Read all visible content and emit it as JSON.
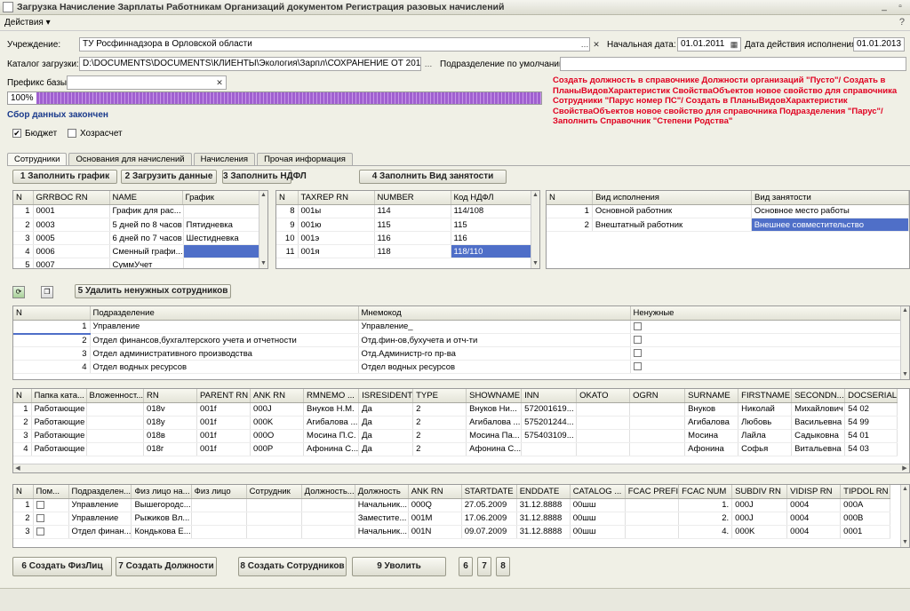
{
  "window": {
    "title": "Загрузка Начисление Зарплаты Работникам Организаций документом Регистрация разовых начислений",
    "minimize": "_",
    "restore": "▫"
  },
  "menu": {
    "actions": "Действия ▾",
    "help": "?"
  },
  "form": {
    "institution_label": "Учреждение:",
    "institution_value": "ТУ Росфиннадзора в Орловской области",
    "start_date_label": "Начальная дата:",
    "start_date_value": "01.01.2011",
    "exec_date_label": "Дата действия исполнения:",
    "exec_date_value": "01.01.2013",
    "catalog_label": "Каталог загрузки:",
    "catalog_value": "D:\\DOCUMENTS\\DOCUMENTS\\КЛИЕНТЫ\\Экология\\Зарпл\\СОХРАНЕНИЕ ОТ 2013-02-07",
    "dept_default_label": "Подразделение по умолчанию:",
    "dept_default_value": "",
    "prefix_label": "Префикс базы:",
    "prefix_value": "",
    "progress_text": "100%",
    "progress_value": 1.0,
    "done_text": "Сбор данных закончен",
    "budget_label": "Бюджет",
    "budget_checked": true,
    "selfsup_label": "Хозрасчет",
    "selfsup_checked": false,
    "red_note": "Создать должность в справочнике Должности организаций \"Пусто\"/ Создать в ПланыВидовХарактеристик СвойстваОбъектов новое свойство для справочника Сотрудники \"Парус номер ПС\"/ Создать в ПланыВидовХарактеристик СвойстваОбъектов новое свойство для справочника Подразделения \"Парус\"/Заполнить Справочник \"Степени Родства\""
  },
  "tabs": [
    "Сотрудники",
    "Основания для начислений",
    "Начисления",
    "Прочая информация"
  ],
  "buttons": {
    "fill_schedule": "1 Заполнить график",
    "load_data": "2 Загрузить данные",
    "fill_ndfl": "3 Заполнить НДФЛ",
    "fill_employment": "4 Заполнить Вид занятости",
    "delete_unneeded": "5 Удалить ненужных сотрудников",
    "create_persons": "6 Создать ФизЛиц",
    "create_positions": "7 Создать Должности",
    "create_employees": "8 Создать Сотрудников",
    "dismiss": "9 Уволить",
    "b6": "6",
    "b7": "7",
    "b8": "8"
  },
  "grid_schedule": {
    "columns": [
      "N",
      "GRRBOC RN",
      "NAME",
      "График"
    ],
    "rows": [
      [
        "1",
        "0001",
        "График для рас...",
        ""
      ],
      [
        "2",
        "0003",
        "5 дней по 8 часов",
        "Пятидневка"
      ],
      [
        "3",
        "0005",
        "6 дней по 7 часов",
        "Шестидневка"
      ],
      [
        "4",
        "0006",
        "Сменный графи...",
        ""
      ],
      [
        "5",
        "0007",
        "СуммУчет",
        ""
      ]
    ]
  },
  "grid_tax": {
    "columns": [
      "N",
      "TAXREP RN",
      "NUMBER",
      "Код НДФЛ"
    ],
    "rows": [
      [
        "8",
        "001ы",
        "114",
        "114/108"
      ],
      [
        "9",
        "001ю",
        "115",
        "115"
      ],
      [
        "10",
        "001э",
        "116",
        "116"
      ],
      [
        "11",
        "001я",
        "118",
        "118/110"
      ]
    ]
  },
  "grid_exec": {
    "columns": [
      "N",
      "Вид исполнения",
      "Вид занятости"
    ],
    "rows": [
      [
        "1",
        "Основной работник",
        "Основное место работы"
      ],
      [
        "2",
        "Внештатный работник",
        "Внешнее совместительство"
      ]
    ]
  },
  "grid_depts": {
    "columns": [
      "N",
      "Подразделение",
      "Мнемокод",
      "Ненужные"
    ],
    "rows": [
      [
        "1",
        "Управление",
        "Управление_",
        false
      ],
      [
        "2",
        "Отдел финансов,бухгалтерского учета и отчетности",
        "Отд.фин-ов,бухучета и отч-ти",
        false
      ],
      [
        "3",
        "Отдел административного производства",
        "Отд.Администр-го пр-ва",
        false
      ],
      [
        "4",
        "Отдел водных ресурсов",
        "Отдел водных ресурсов",
        false
      ]
    ]
  },
  "grid_persons": {
    "columns": [
      "N",
      "Папка ката...",
      "Вложенност...",
      "RN",
      "PARENT RN",
      "ANK RN",
      "RMNEMO ...",
      "ISRESIDENT",
      "TYPE",
      "SHOWNAME",
      "INN",
      "OKATO",
      "OGRN",
      "SURNAME",
      "FIRSTNAME",
      "SECONDN...",
      "DOCSERIAL"
    ],
    "rows": [
      [
        "1",
        "Работающие",
        "",
        "018v",
        "001f",
        "000J",
        "Внуков Н.М.",
        "Да",
        "2",
        "Внуков Ни...",
        "572001619...",
        "",
        "",
        "Внуков",
        "Николай",
        "Михайлович",
        "54 02"
      ],
      [
        "2",
        "Работающие",
        "",
        "018y",
        "001f",
        "000K",
        "Агибалова ...",
        "Да",
        "2",
        "Агибалова ...",
        "575201244...",
        "",
        "",
        "Агибалова",
        "Любовь",
        "Васильевна",
        "54 99"
      ],
      [
        "3",
        "Работающие",
        "",
        "018в",
        "001f",
        "000O",
        "Мосина П.С.",
        "Да",
        "2",
        "Мосина Па...",
        "575403109...",
        "",
        "",
        "Мосина",
        "Лайла",
        "Садыковна",
        "54 01"
      ],
      [
        "4",
        "Работающие",
        "",
        "018г",
        "001f",
        "000P",
        "Афонина С...",
        "Да",
        "2",
        "Афонина С...",
        "",
        "",
        "",
        "Афонина",
        "Софья",
        "Витальевна",
        "54 03"
      ]
    ]
  },
  "grid_staff": {
    "columns": [
      "N",
      "Пом...",
      "Подразделен...",
      "Физ лицо на...",
      "Физ лицо",
      "Сотрудник",
      "Должность...",
      "Должность",
      "ANK RN",
      "STARTDATE",
      "ENDDATE",
      "CATALOG ...",
      "FCAC PREFI",
      "FCAC NUM",
      "SUBDIV RN",
      "VIDISP RN",
      "TIPDOL RN"
    ],
    "rows": [
      [
        "1",
        "",
        "Управление",
        "Вышегородс...",
        "",
        "",
        "",
        "Начальник...",
        "000Q",
        "27.05.2009",
        "31.12.8888",
        "00шш",
        "",
        "1.",
        "000J",
        "0004",
        "000A"
      ],
      [
        "2",
        "",
        "Управление",
        "Рыжиков Вл...",
        "",
        "",
        "",
        "Заместите...",
        "001M",
        "17.06.2009",
        "31.12.8888",
        "00шш",
        "",
        "2.",
        "000J",
        "0004",
        "000B"
      ],
      [
        "3",
        "",
        "Отдел финан...",
        "Кондькова Е...",
        "",
        "",
        "",
        "Начальник...",
        "001N",
        "09.07.2009",
        "31.12.8888",
        "00шш",
        "",
        "4.",
        "000K",
        "0004",
        "0001"
      ]
    ]
  }
}
